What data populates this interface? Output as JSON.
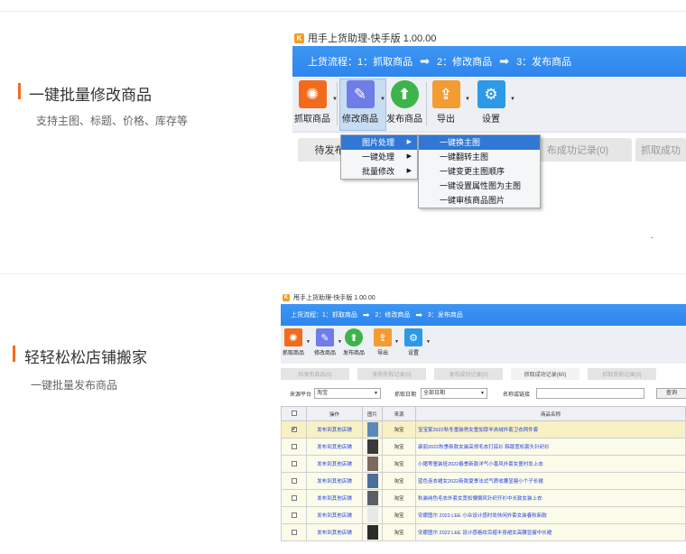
{
  "sections": [
    {
      "title": "一键批量修改商品",
      "subtitle": "支持主图、标题、价格、库存等"
    },
    {
      "title": "轻轻松松店铺搬家",
      "subtitle": "一键批量发布商品"
    }
  ],
  "app": {
    "title": "甩手上货助理-快手版 1.00.00",
    "flow_label": "上货流程：",
    "flow_steps": [
      "1：抓取商品",
      "2：修改商品",
      "3：发布商品"
    ],
    "toolbar": [
      {
        "label": "抓取商品",
        "icon": "spider-web-icon",
        "color": "#f26b1d"
      },
      {
        "label": "修改商品",
        "icon": "edit-pencil-icon",
        "color": "#6f7de8"
      },
      {
        "label": "发布商品",
        "icon": "upload-arrow-icon",
        "color": "#3cb44b"
      },
      {
        "label": "导出",
        "icon": "export-share-icon",
        "color": "#f39c33"
      },
      {
        "label": "设置",
        "icon": "gear-icon",
        "color": "#2d9ae8"
      }
    ]
  },
  "screen1": {
    "tabs": [
      "待发布",
      "布成功记录(0)",
      "抓取成功"
    ],
    "menu1": [
      {
        "label": "图片处理",
        "selected": true,
        "has_sub": true
      },
      {
        "label": "一键处理",
        "selected": false,
        "has_sub": true
      },
      {
        "label": "批量修改",
        "selected": false,
        "has_sub": true
      }
    ],
    "menu2": [
      {
        "label": "一键换主图",
        "selected": true
      },
      {
        "label": "一键翻转主图",
        "selected": false
      },
      {
        "label": "一键变更主图顺序",
        "selected": false
      },
      {
        "label": "一键设置属性图为主图",
        "selected": false
      },
      {
        "label": "一键审核商品图片",
        "selected": false
      }
    ],
    "dot": "-"
  },
  "screen2": {
    "tabs": [
      {
        "label": "待发布商品(0)",
        "active": false
      },
      {
        "label": "发布失败记录(0)",
        "active": false
      },
      {
        "label": "发布成功记录(0)",
        "active": false
      },
      {
        "label": "抓取成功记录(60)",
        "active": true
      },
      {
        "label": "抓取失败记录(0)",
        "active": false
      }
    ],
    "filter": {
      "source_label": "来源平台",
      "source_value": "淘宝",
      "date_label": "抓取日期",
      "date_value": "全部日期",
      "name_label": "名称或链接",
      "name_value": "",
      "query_button": "查询"
    },
    "columns": [
      "",
      "操作",
      "图片",
      "来源",
      "商品名称"
    ],
    "rows": [
      {
        "checked": true,
        "action": "发布到其他店铺",
        "source": "淘宝",
        "name": "宝宝家2022秋冬童装男女童加厚羊羔绒外套卫衣两件套",
        "thumb": "#5b88b8"
      },
      {
        "checked": false,
        "action": "发布到其他店铺",
        "source": "淘宝",
        "name": "裴丽2022秋季新款女装高领毛衣打底衫 韩版宽松套头针织衫",
        "thumb": "#3a3a3a"
      },
      {
        "checked": false,
        "action": "发布到其他店铺",
        "source": "淘宝",
        "name": "小猪等童装班2022春季新款洋气小香风外套女童时尚上衣",
        "thumb": "#7a6a60"
      },
      {
        "checked": false,
        "action": "发布到其他店铺",
        "source": "淘宝",
        "name": "蓝色连衣裙女2022新款夏季法式气质收腰显瘦小个子长裙",
        "thumb": "#4b6f9a"
      },
      {
        "checked": false,
        "action": "发布到其他店铺",
        "source": "淘宝",
        "name": "秋装纯色毛衣外套女宽松慵懒风针织开衫中长款女装上衣",
        "thumb": "#5a5f66"
      },
      {
        "checked": false,
        "action": "发布到其他店铺",
        "source": "淘宝",
        "name": "安娜图尔 2022 LEE 小众设计感时尚休闲外套女装春秋新款",
        "thumb": "#e8e8e8"
      },
      {
        "checked": false,
        "action": "发布到其他店铺",
        "source": "淘宝",
        "name": "安娜图尔 2022 LEE 设计感格纹百褶半身裙女高腰显瘦中长裙",
        "thumb": "#2c2c2c"
      }
    ]
  }
}
